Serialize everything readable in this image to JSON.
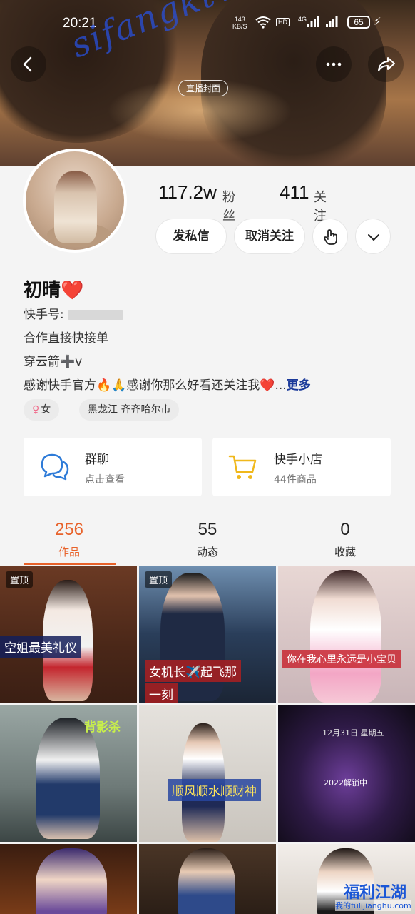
{
  "status_bar": {
    "time": "20:21",
    "speed_value": "143",
    "speed_unit": "KB/S",
    "hd": "HD",
    "net": "4G",
    "battery": "65"
  },
  "cover": {
    "live_badge": "直播封面"
  },
  "profile": {
    "followers_count": "117.2w",
    "followers_label": "粉丝",
    "following_count": "411",
    "following_label": "关注",
    "message_button": "发私信",
    "unfollow_button": "取消关注",
    "name": "初晴",
    "name_emoji": "❤️",
    "kuaishou_id_label": "快手号:",
    "bio_line1": "合作直接快接单",
    "bio_line2": "穿云箭➕v",
    "bio_line3": "感谢快手官方🔥🙏感谢你那么好看还关注我❤️...",
    "bio_more": "更多",
    "gender_tag": "女",
    "location_tag": "黑龙江 齐齐哈尔市"
  },
  "features": {
    "group_title": "群聊",
    "group_sub": "点击查看",
    "shop_title": "快手小店",
    "shop_sub": "44件商品"
  },
  "tabs": [
    {
      "count": "256",
      "label": "作品"
    },
    {
      "count": "55",
      "label": "动态"
    },
    {
      "count": "0",
      "label": "收藏"
    }
  ],
  "grid": {
    "pinned_label": "置顶",
    "captions": [
      "空姐最美礼仪",
      "女机长✈️起飞那",
      "一刻",
      "你在我心里永远是小宝贝",
      "背影杀",
      "顺风顺水顺财神",
      "12月31日 星期五",
      "2022解锁中"
    ]
  },
  "watermark": {
    "main": "sifangktv.com",
    "corner_top": "福利江湖",
    "corner_bottom": "我的fulijianghu.com"
  },
  "colors": {
    "accent": "#e8622a",
    "link": "#1b3a9a",
    "watermark": "#1a56d6"
  }
}
